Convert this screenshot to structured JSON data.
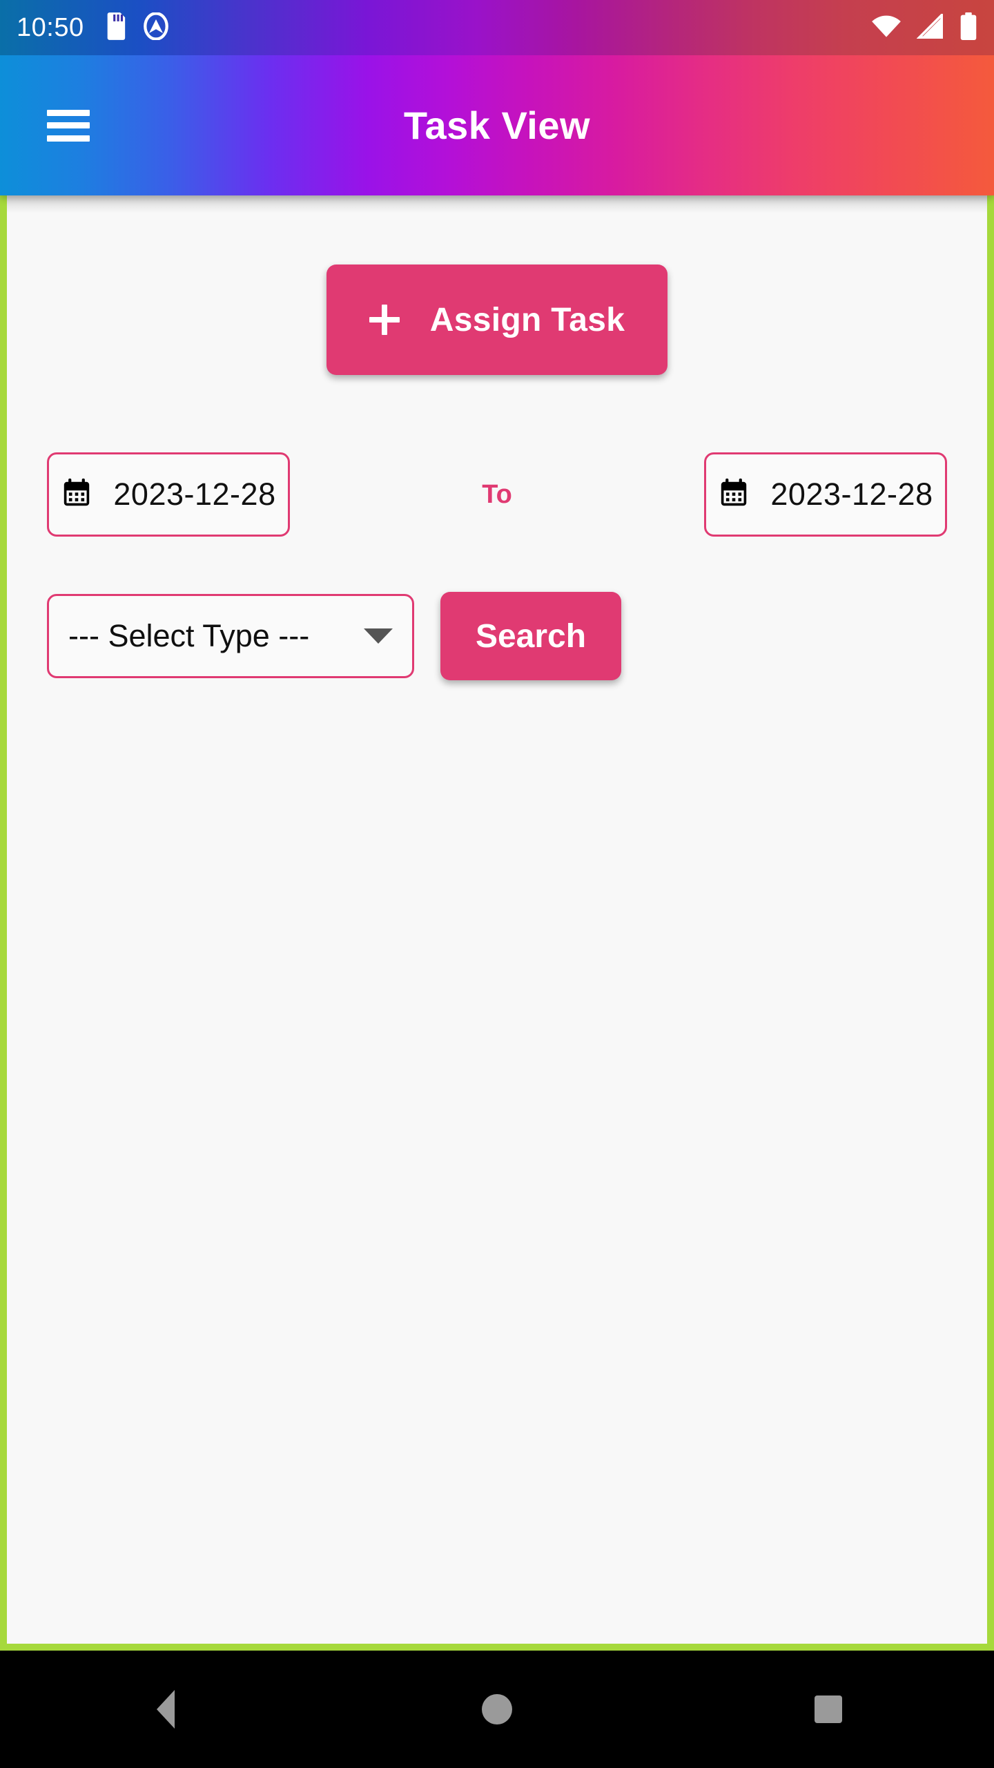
{
  "status_bar": {
    "time": "10:50",
    "left_icons": [
      "sd-card-icon",
      "app-notification-icon"
    ],
    "right_icons": [
      "wifi-icon",
      "cellular-signal-off-icon",
      "battery-icon"
    ]
  },
  "app_bar": {
    "title": "Task View",
    "menu_icon": "hamburger-menu-icon",
    "gradient_start": "#0d8fd9",
    "gradient_mid": "#9a12e8",
    "gradient_end": "#f45a3c"
  },
  "theme": {
    "accent": "#e03a72",
    "frame_border": "#a6d93c",
    "content_bg": "#f8f8f8"
  },
  "main": {
    "assign_button": {
      "label": "Assign Task",
      "icon": "plus-icon"
    },
    "date_range": {
      "from": {
        "value": "2023-12-28",
        "icon": "calendar-icon"
      },
      "separator_label": "To",
      "to": {
        "value": "2023-12-28",
        "icon": "calendar-icon"
      }
    },
    "type_select": {
      "selected": "--- Select Type ---",
      "caret_icon": "chevron-down-icon"
    },
    "search_button": {
      "label": "Search"
    },
    "results": []
  },
  "nav_bar": {
    "back": "back-icon",
    "home": "home-icon",
    "recents": "recents-icon"
  }
}
